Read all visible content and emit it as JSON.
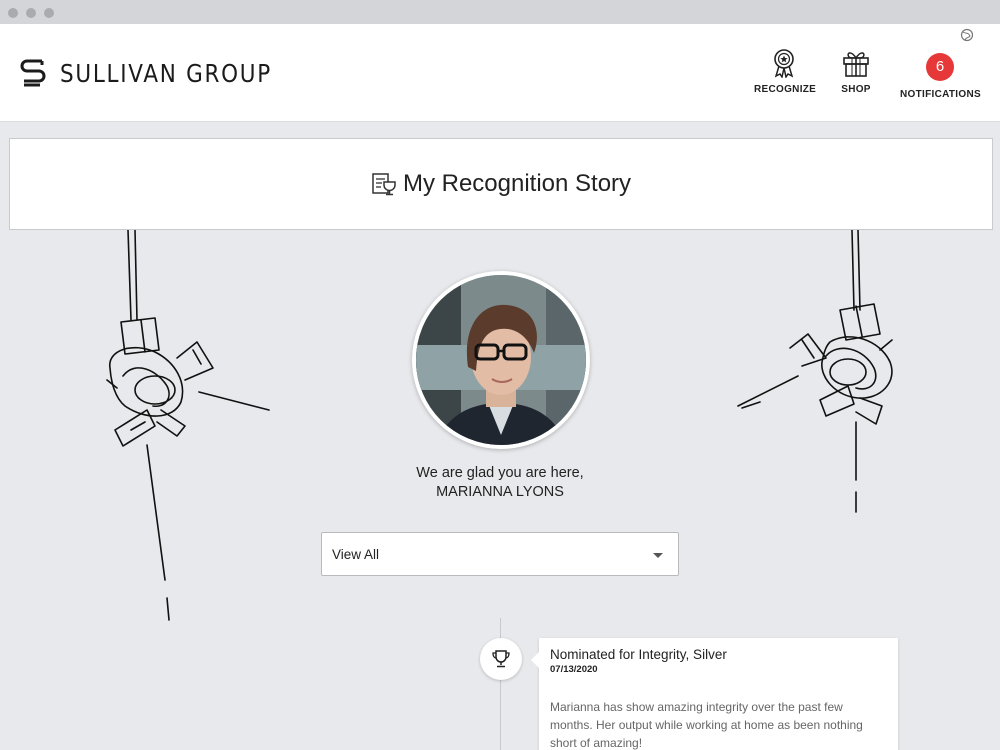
{
  "brand": {
    "name": "SULLIVAN GROUP",
    "logo_icon": "sullivan-s-logo-icon"
  },
  "nav": {
    "items": [
      {
        "label": "RECOGNIZE",
        "icon": "ribbon-award-icon"
      },
      {
        "label": "SHOP",
        "icon": "gift-icon"
      },
      {
        "label": "NOTIFICATIONS",
        "icon": "notification-badge",
        "count": "6"
      }
    ]
  },
  "page": {
    "title": "My Recognition Story",
    "title_icon": "certificate-trophy-icon"
  },
  "profile": {
    "greeting": "We are glad you are here,",
    "name": "MARIANNA LYONS"
  },
  "filter": {
    "selected": "View All"
  },
  "timeline": {
    "events": [
      {
        "icon": "trophy-icon",
        "title": "Nominated for Integrity, Silver",
        "date": "07/13/2020",
        "body": "Marianna has show amazing integrity over the past few months. Her output while working at home as been nothing short of amazing!"
      }
    ]
  },
  "colors": {
    "badge": "#e63838",
    "background": "#e8e9ec",
    "surface": "#ffffff"
  }
}
